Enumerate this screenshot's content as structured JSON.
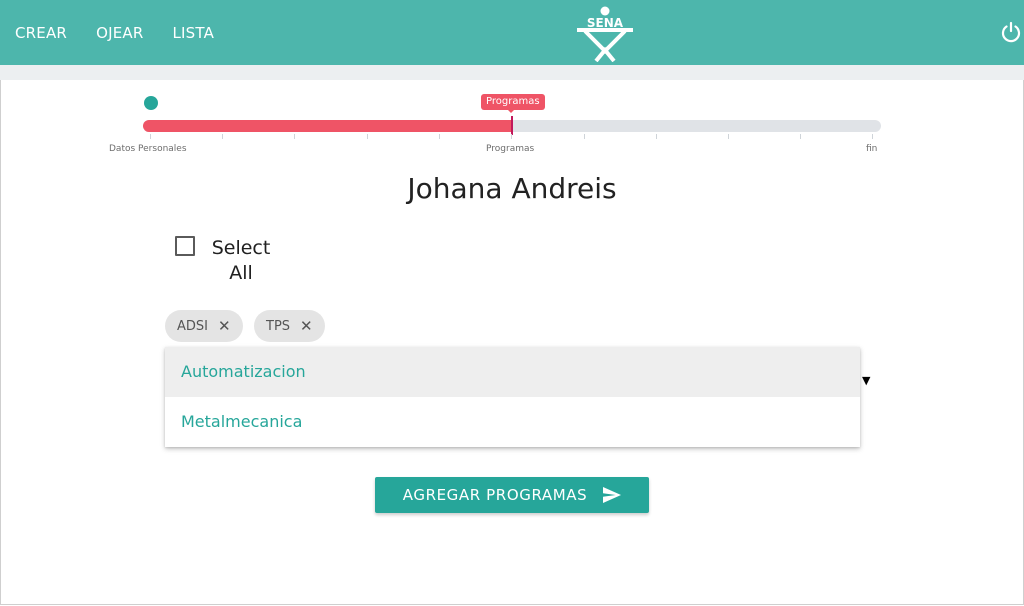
{
  "nav": {
    "links": [
      "CREAR",
      "OJEAR",
      "LISTA"
    ],
    "logo_text": "SENA",
    "color": "#4db6ac"
  },
  "stepper": {
    "tooltip": "Programas",
    "progress_fraction": 0.5,
    "labels": {
      "start": "Datos Personales",
      "middle": "Programas",
      "end": "fin"
    }
  },
  "user": {
    "name": "Johana Andreis"
  },
  "select_all": {
    "label": "Select All",
    "checked": false
  },
  "chips": [
    {
      "label": "ADSI"
    },
    {
      "label": "TPS"
    }
  ],
  "dropdown": {
    "options": [
      "Automatizacion",
      "Metalmecanica"
    ],
    "highlighted": "Automatizacion"
  },
  "submit": {
    "label": "AGREGAR PROGRAMAS",
    "icon": "send-icon",
    "color": "#26a69a"
  }
}
